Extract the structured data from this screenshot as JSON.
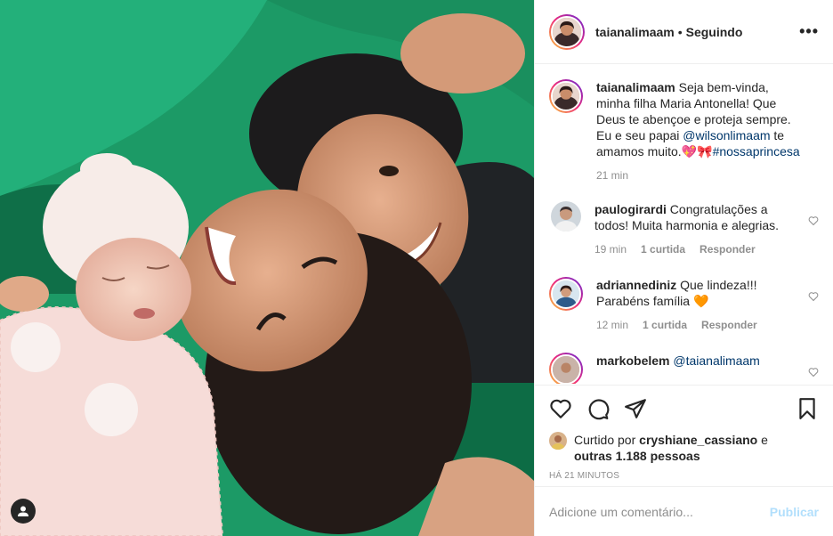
{
  "post": {
    "photo_alt": "",
    "tag_icon": "user-silhouette-icon"
  },
  "header": {
    "username": "taianalimaam",
    "separator": "•",
    "follow_status": "Seguindo",
    "more": "•••"
  },
  "caption": {
    "username": "taianalimaam",
    "text_1": "Seja bem-vinda, minha filha Maria Antonella! Que Deus te abençoe e proteja sempre. Eu e seu papai ",
    "mention": "@wilsonlimaam",
    "text_2": " te amamos muito.",
    "emoji": "💖🎀",
    "hashtag": "#nossaprincesa",
    "time": "21 min"
  },
  "comments": [
    {
      "username": "paulogirardi",
      "text": "Congratulações a todos! Muita harmonia e alegrias.",
      "time": "19 min",
      "likes": "1 curtida",
      "reply": "Responder"
    },
    {
      "username": "adriannediniz",
      "text": "Que lindeza!!! Parabéns família 🧡",
      "time": "12 min",
      "likes": "1 curtida",
      "reply": "Responder"
    },
    {
      "username": "markobelem",
      "mention": "@taianalimaam"
    }
  ],
  "likes": {
    "prefix": "Curtido por ",
    "user": "cryshiane_cassiano",
    "middle": " e ",
    "others": "outras 1.188 pessoas"
  },
  "timestamp": "HÁ 21 MINUTOS",
  "add_comment": {
    "placeholder": "Adicione um comentário...",
    "publish": "Publicar"
  },
  "colors": {
    "link": "#00376b",
    "muted": "#8e8e8e",
    "publish_disabled": "#b2dffc"
  }
}
